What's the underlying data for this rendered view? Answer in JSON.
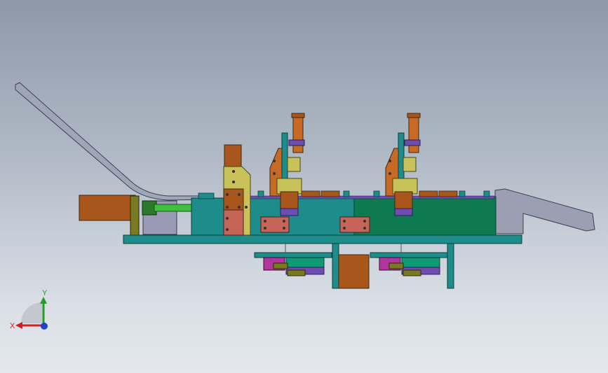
{
  "viewport": {
    "background_top": "#8d98a9",
    "background_bottom": "#e4e8ee"
  },
  "colors": {
    "frame_teal": "#1d8c8a",
    "frame_green": "#0e7a4f",
    "frame_edge": "#0b4f4a",
    "orange_brown": "#a8561c",
    "orange_cyl": "#c66a25",
    "olive_yellow": "#c9c25a",
    "salmon": "#c7645a",
    "magenta": "#b0359e",
    "purple": "#6d4db0",
    "lavender": "#9b9ab4",
    "gray_chute": "#8f92a6",
    "lime": "#3fbf3f",
    "dark_olive": "#7a7a22"
  },
  "triad": {
    "x_label": "X",
    "y_label": "Y",
    "x_color": "#d02020",
    "y_color": "#20a020",
    "z_color": "#2040d0"
  }
}
